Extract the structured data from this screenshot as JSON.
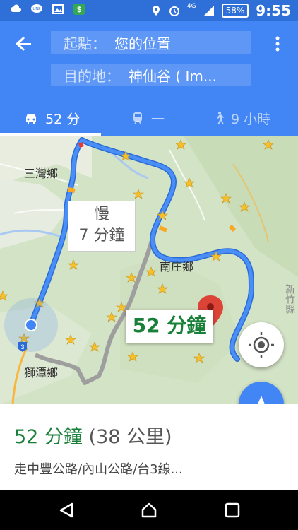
{
  "status_bar": {
    "network": "4G",
    "battery": "58%",
    "time": "9:55",
    "icons": [
      "cloud-upload-icon",
      "line-icon",
      "image-icon",
      "s-app-icon",
      "location-icon",
      "alarm-icon",
      "signal-icon",
      "battery-icon"
    ]
  },
  "header": {
    "start_label": "起點：",
    "start_value": "您的位置",
    "dest_label": "目的地：",
    "dest_value": "神仙谷 ( Im..."
  },
  "modes": [
    {
      "name": "driving",
      "label": "52 分",
      "active": true
    },
    {
      "name": "transit",
      "label": "一",
      "active": false
    },
    {
      "name": "walking",
      "label": "9 小時",
      "active": false
    }
  ],
  "map": {
    "places": [
      "三灣鄉",
      "南庄鄉",
      "獅潭鄉"
    ],
    "alt_route_callout": {
      "line1": "慢",
      "line2": "7 分鐘"
    },
    "route_callout": "52 分鐘",
    "road_shield": "3",
    "side_text": "新竹縣"
  },
  "sheet": {
    "duration": "52 分鐘",
    "distance": "(38 公里)",
    "via": "走中豐公路/內山公路/台3線..."
  },
  "colors": {
    "header_bg": "#4285f4",
    "status_bg": "#2f6fd8",
    "route": "#4285f4",
    "alt_route": "#9e9e9e",
    "duration_green": "#188038"
  }
}
